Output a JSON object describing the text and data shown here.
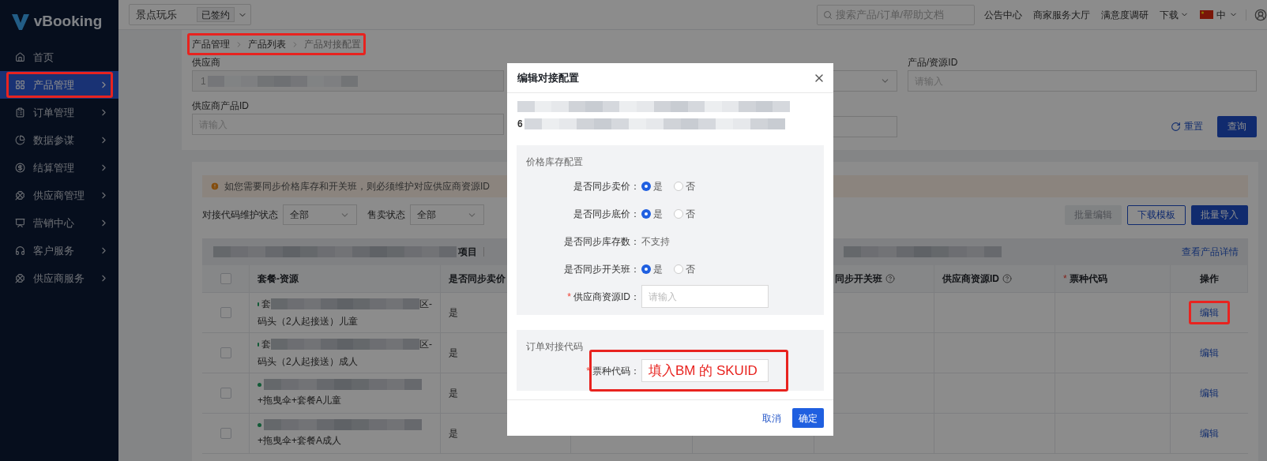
{
  "app": {
    "logo": "vBooking"
  },
  "sidebar": {
    "items": [
      {
        "label": "首页",
        "selected": false,
        "expandable": false,
        "highlighted": false
      },
      {
        "label": "产品管理",
        "selected": true,
        "expandable": true,
        "highlighted": true
      },
      {
        "label": "订单管理",
        "selected": false,
        "expandable": true,
        "highlighted": false
      },
      {
        "label": "数据参谋",
        "selected": false,
        "expandable": true,
        "highlighted": false
      },
      {
        "label": "结算管理",
        "selected": false,
        "expandable": true,
        "highlighted": false
      },
      {
        "label": "供应商管理",
        "selected": false,
        "expandable": true,
        "highlighted": false
      },
      {
        "label": "营销中心",
        "selected": false,
        "expandable": true,
        "highlighted": false
      },
      {
        "label": "客户服务",
        "selected": false,
        "expandable": true,
        "highlighted": false
      },
      {
        "label": "供应商服务",
        "selected": false,
        "expandable": true,
        "highlighted": false
      }
    ]
  },
  "header": {
    "category": {
      "value": "景点玩乐",
      "badge": "已签约"
    },
    "search": {
      "placeholder": "搜索产品/订单/帮助文档"
    },
    "links": [
      {
        "label": "公告中心",
        "dropdown": false
      },
      {
        "label": "商家服务大厅",
        "dropdown": false
      },
      {
        "label": "满意度调研",
        "dropdown": false
      },
      {
        "label": "下载",
        "dropdown": true
      }
    ],
    "language": {
      "label": "中"
    }
  },
  "breadcrumb": {
    "items": [
      "产品管理",
      "产品列表",
      "产品对接配置"
    ],
    "highlighted": true
  },
  "filters": {
    "supplier": {
      "label": "供应商",
      "value_start": "1"
    },
    "supplier_product_id": {
      "label": "供应商产品ID",
      "placeholder": "请输入"
    },
    "product_resource_id": {
      "label": "产品/资源ID",
      "placeholder": "请输入"
    },
    "reset": "重置",
    "search": "查询"
  },
  "notice": "如您需要同步价格库存和开关班，则必须维护对应供应商资源ID",
  "list_filters": [
    {
      "label": "对接代码维护状态",
      "value": "全部"
    },
    {
      "label": "售卖状态",
      "value": "全部"
    }
  ],
  "actions": [
    {
      "label": "批量编辑",
      "kind": "disabled"
    },
    {
      "label": "下载模板",
      "kind": "outline"
    },
    {
      "label": "批量导入",
      "kind": "primary"
    }
  ],
  "product_bar": {
    "label": "项目",
    "link": "查看产品详情"
  },
  "table": {
    "all_checked": false,
    "columns": [
      {
        "kind": "checkbox"
      },
      {
        "kind": "text",
        "label": "套餐-资源",
        "help": false
      },
      {
        "kind": "text",
        "label": "是否同步卖价",
        "help": false
      },
      {
        "kind": "text",
        "label": "同步开关班",
        "help": true
      },
      {
        "kind": "text",
        "label": "供应商资源ID",
        "help": true
      },
      {
        "kind": "text",
        "label": "票种代码",
        "help": false,
        "required_mark": "*"
      },
      {
        "kind": "text",
        "label": "操作",
        "help": false
      }
    ],
    "rows": [
      {
        "checked": false,
        "name_start": "套",
        "name_end": "区-",
        "name_line2": "码头（2人起接送）儿童",
        "sync_price": "是",
        "action": "编辑",
        "action_highlighted": true
      },
      {
        "checked": false,
        "name_start": "套",
        "name_end": "区-",
        "name_line2": "码头（2人起接送）成人",
        "sync_price": "是",
        "action": "编辑",
        "action_highlighted": false
      },
      {
        "checked": false,
        "name_line2": "+拖曳伞+套餐A儿童",
        "sync_price": "是",
        "action": "编辑",
        "action_highlighted": false
      },
      {
        "checked": false,
        "name_line2": "+拖曳伞+套餐A成人",
        "sync_price": "是",
        "action": "编辑",
        "action_highlighted": false
      }
    ]
  },
  "modal": {
    "title": "编辑对接配置",
    "info_line2_start": "6",
    "sections": [
      {
        "title": "价格库存配置",
        "fields": [
          {
            "kind": "radio",
            "label": "是否同步卖价：",
            "options": [
              {
                "label": "是",
                "selected": true
              },
              {
                "label": "否",
                "selected": false
              }
            ]
          },
          {
            "kind": "radio",
            "label": "是否同步底价：",
            "options": [
              {
                "label": "是",
                "selected": true
              },
              {
                "label": "否",
                "selected": false
              }
            ]
          },
          {
            "kind": "text",
            "label": "是否同步库存数：",
            "value": "不支持"
          },
          {
            "kind": "radio",
            "label": "是否同步开关班：",
            "options": [
              {
                "label": "是",
                "selected": true
              },
              {
                "label": "否",
                "selected": false
              }
            ]
          },
          {
            "kind": "input",
            "required_mark": "*",
            "label": "供应商资源ID：",
            "placeholder": "请输入",
            "highlighted": false
          }
        ]
      },
      {
        "title": "订单对接代码",
        "fields": [
          {
            "kind": "input",
            "required_mark": "*",
            "label": "票种代码：",
            "annotation": "填入BM 的 SKUID",
            "highlighted": true
          }
        ]
      }
    ],
    "cancel": "取消",
    "ok": "确定"
  }
}
